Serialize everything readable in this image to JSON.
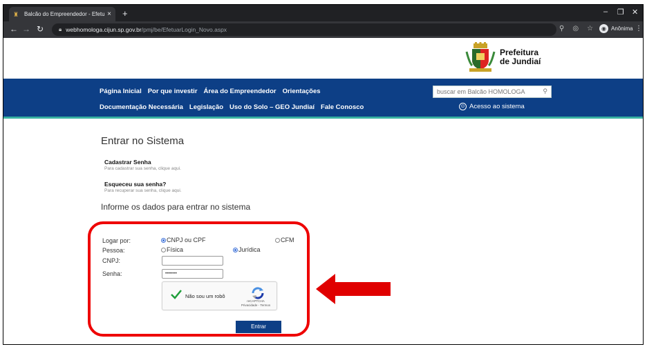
{
  "browser": {
    "tab_title": "Balcão do Empreendedor - Efetu",
    "tab_close": "×",
    "new_tab": "+",
    "url_host": "webhomologa.cijun.sp.gov.br",
    "url_path": "/pmj/be/EfetuarLogin_Novo.aspx",
    "profile_name": "Anônima"
  },
  "header": {
    "logo_line1": "Prefeitura",
    "logo_line2": "de Jundiaí"
  },
  "nav": {
    "row1": [
      "Página Inicial",
      "Por que investir",
      "Área do Empreendedor",
      "Orientações"
    ],
    "row2": [
      "Documentação Necessária",
      "Legislação",
      "Uso do Solo – GEO Jundiaí",
      "Fale Conosco"
    ],
    "search_placeholder": "buscar em Balcão HOMOLOGA",
    "access_label": "Acesso ao sistema"
  },
  "main": {
    "title": "Entrar no Sistema",
    "register_title": "Cadastrar Senha",
    "register_sub": "Para cadastrar sua senha, clique aqui.",
    "forgot_title": "Esqueceu sua senha?",
    "forgot_sub": "Para recuperar sua senha, clique aqui.",
    "form_heading": "Informe os dados para entrar no sistema"
  },
  "form": {
    "login_by_label": "Logar por:",
    "opt_cnpj_cpf": "CNPJ ou CPF",
    "opt_cfm": "CFM",
    "person_label": "Pessoa:",
    "opt_fisica": "Física",
    "opt_juridica": "Jurídica",
    "cnpj_label": "CNPJ:",
    "cnpj_value": "",
    "password_label": "Senha:",
    "password_value": "••••••••",
    "captcha_label": "Não sou um robô",
    "captcha_brand": "reCAPTCHA",
    "captcha_links": "Privacidade - Termos",
    "submit_label": "Entrar"
  },
  "colors": {
    "navbar": "#0d3f86",
    "accent": "#38b1a2",
    "highlight": "#e00000"
  }
}
